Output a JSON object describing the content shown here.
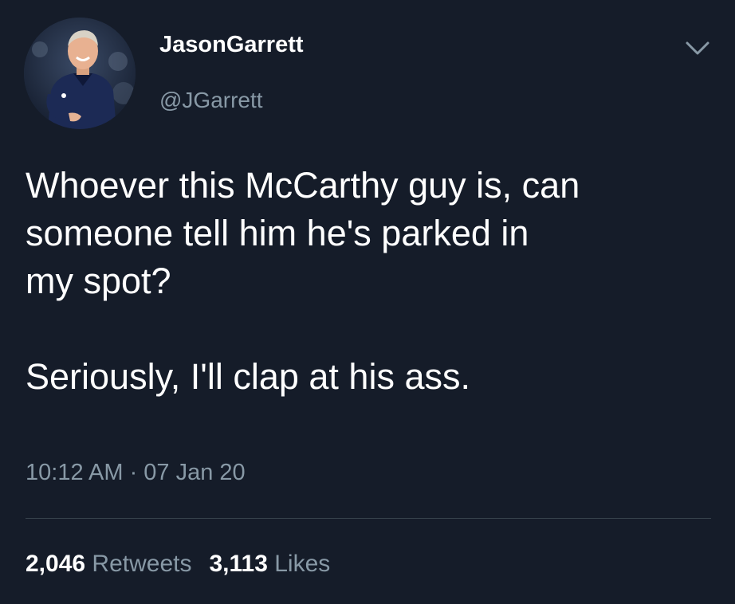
{
  "user": {
    "display_name": "JasonGarrett",
    "handle": "@JGarrett"
  },
  "tweet": {
    "lines_para1": [
      "Whoever this McCarthy guy is, can",
      "someone tell him he's parked in",
      "my spot?"
    ],
    "lines_para2": [
      "Seriously, I'll clap at his ass."
    ],
    "timestamp": "10:12 AM · 07 Jan 20"
  },
  "stats": {
    "retweets_count": "2,046",
    "retweets_label": "Retweets",
    "likes_count": "3,113",
    "likes_label": "Likes"
  },
  "colors": {
    "background": "#151c29",
    "primary_text": "#ffffff",
    "secondary_text": "#8899a6",
    "divider": "#38444d"
  },
  "icons": {
    "menu": "chevron-down-icon"
  }
}
